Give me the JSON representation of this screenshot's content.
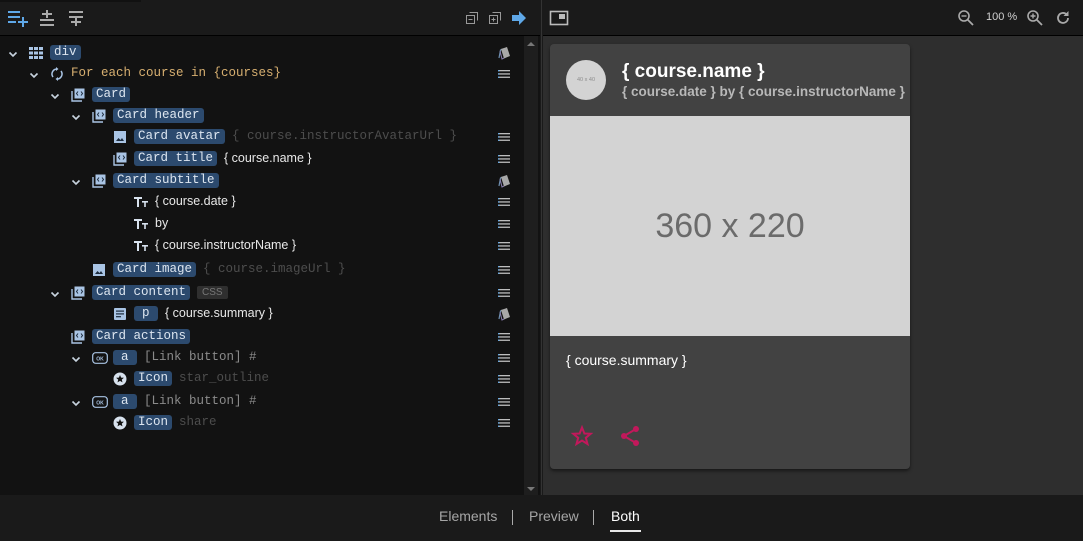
{
  "left_toolbar": {
    "buttons": [
      {
        "name": "add-element",
        "icon": "playlist-add-icon",
        "color": "#5fa8e8"
      },
      {
        "name": "insert-between",
        "icon": "vertical-split-icon",
        "color": "#aaaaaa"
      },
      {
        "name": "wrap",
        "icon": "vertical-align-icon",
        "color": "#aaaaaa"
      }
    ],
    "right_buttons": [
      {
        "name": "collapse-all",
        "icon": "collapse-all-icon"
      },
      {
        "name": "expand-all",
        "icon": "expand-all-icon"
      },
      {
        "name": "go-to",
        "icon": "arrow-right-icon",
        "color": "#5fa8e8"
      }
    ]
  },
  "tree": {
    "rows": [
      {
        "chip": "div",
        "after": "",
        "after_style": "",
        "icon": "grid-icon",
        "action": "style-icon"
      },
      {
        "chip": "",
        "after": "For each course in {courses}",
        "after_style": "loop",
        "icon": "loop-icon",
        "action": "list-icon"
      },
      {
        "chip": "Card",
        "after": "",
        "after_style": "",
        "icon": "component-icon",
        "action": ""
      },
      {
        "chip": "Card header",
        "after": "",
        "after_style": "",
        "icon": "component-icon",
        "action": ""
      },
      {
        "chip": "Card avatar",
        "after": "{ course.instructorAvatarUrl }",
        "after_style": "mono",
        "icon": "image-icon",
        "action": "list-icon"
      },
      {
        "chip": "Card title",
        "after": "{ course.name }",
        "after_style": "sans",
        "icon": "component-icon",
        "action": "list-icon"
      },
      {
        "chip": "Card subtitle",
        "after": "",
        "after_style": "",
        "icon": "component-icon",
        "action": "style-icon"
      },
      {
        "chip": "",
        "after": "{ course.date }",
        "after_style": "sans",
        "icon": "text-icon",
        "action": "list-icon"
      },
      {
        "chip": "",
        "after": "by",
        "after_style": "sans",
        "icon": "text-icon",
        "action": "list-icon"
      },
      {
        "chip": "",
        "after": "{ course.instructorName }",
        "after_style": "sans",
        "icon": "text-icon",
        "action": "list-icon"
      },
      {
        "chip": "Card image",
        "after": "{ course.imageUrl }",
        "after_style": "mono",
        "icon": "image-icon",
        "action": "list-icon"
      },
      {
        "chip": "Card content",
        "after": "",
        "after_style": "",
        "badge": "CSS",
        "icon": "component-icon",
        "action": "list-icon"
      },
      {
        "chip": "p",
        "after": "{ course.summary }",
        "after_style": "sans",
        "icon": "paragraph-icon",
        "action": "style-icon"
      },
      {
        "chip": "Card actions",
        "after": "",
        "after_style": "",
        "icon": "component-icon",
        "action": "list-icon"
      },
      {
        "chip": "a",
        "after": "[Link button] #",
        "after_style": "muted",
        "icon": "button-icon",
        "action": "list-icon"
      },
      {
        "chip": "Icon",
        "after": "star_outline",
        "after_style": "mono",
        "icon": "material-icon",
        "action": "list-icon"
      },
      {
        "chip": "a",
        "after": "[Link button] #",
        "after_style": "muted",
        "icon": "button-icon",
        "action": "list-icon"
      },
      {
        "chip": "Icon",
        "after": "share",
        "after_style": "mono",
        "icon": "material-icon",
        "action": "list-icon"
      }
    ]
  },
  "right_toolbar": {
    "frame_toggle": "frame-icon",
    "zoom_out": "zoom-out-icon",
    "zoom_level": "100 %",
    "zoom_in": "zoom-in-icon",
    "reset": "refresh-icon"
  },
  "preview": {
    "card": {
      "avatar_placeholder": "40 x 40",
      "title": "{ course.name }",
      "subtitle": "{ course.date } by { course.instructorName }",
      "image_placeholder": "360 x 220",
      "content": "{ course.summary }",
      "actions": [
        {
          "icon": "star-outline-icon"
        },
        {
          "icon": "share-icon"
        }
      ],
      "accent": "#c2185b"
    }
  },
  "view_tabs": {
    "items": [
      {
        "label": "Elements",
        "active": false
      },
      {
        "label": "Preview",
        "active": false
      },
      {
        "label": "Both",
        "active": true
      }
    ]
  }
}
